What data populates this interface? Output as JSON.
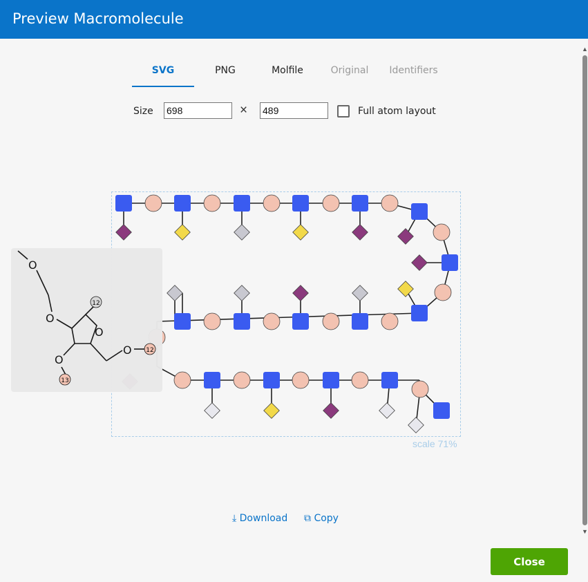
{
  "header": {
    "title": "Preview Macromolecule"
  },
  "tabs": [
    {
      "label": "SVG"
    },
    {
      "label": "PNG"
    },
    {
      "label": "Molfile"
    },
    {
      "label": "Original"
    },
    {
      "label": "Identifiers"
    }
  ],
  "size": {
    "label": "Size",
    "width": "698",
    "height": "489",
    "times": "×",
    "full_atom_label": "Full atom layout"
  },
  "preview": {
    "scale_text": "scale 71%",
    "popup_labels": {
      "a": "12",
      "b": "13",
      "o": "O",
      "p": "12"
    }
  },
  "actions": {
    "download": "Download",
    "copy": "Copy"
  },
  "footer": {
    "close": "Close"
  },
  "colors": {
    "accent": "#0a74c9",
    "close": "#4ea504",
    "sugar": "#3a5bf0",
    "base": "#f3c2b1",
    "phosphate_purple": "#8b3a7d",
    "phosphate_yellow": "#f2d94a",
    "phosphate_gray": "#c8c8d0"
  }
}
